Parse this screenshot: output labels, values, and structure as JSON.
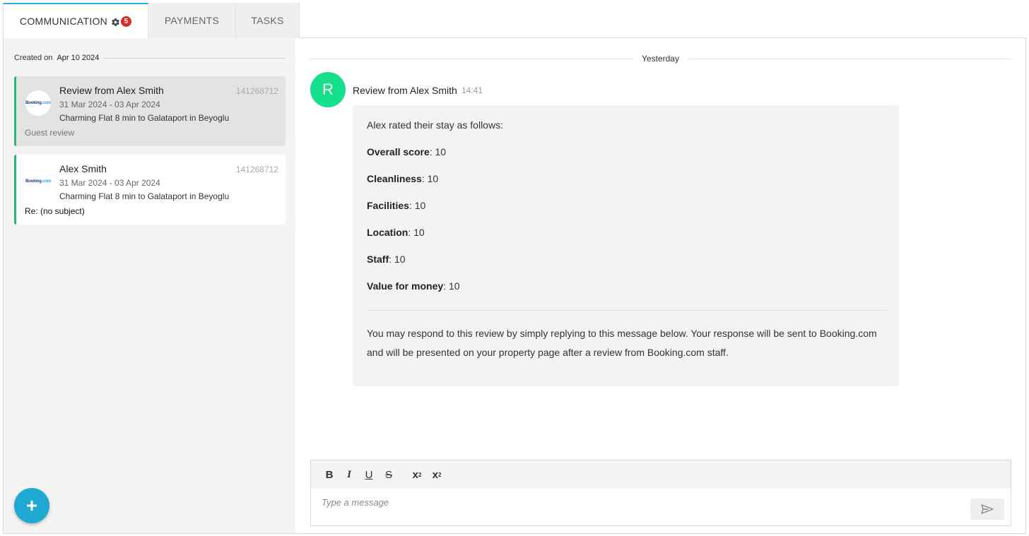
{
  "tabs": [
    {
      "label": "COMMUNICATION",
      "badge": "5",
      "active": true
    },
    {
      "label": "PAYMENTS",
      "active": false
    },
    {
      "label": "TASKS",
      "active": false
    }
  ],
  "sidebar": {
    "created_label": "Created on",
    "created_date": "Apr 10 2024",
    "conversations": [
      {
        "title": "Review from Alex Smith",
        "number": "141268712",
        "dates": "31 Mar 2024 - 03 Apr 2024",
        "property": "Charming Flat 8 min to Galataport in Beyoglu",
        "footer": "Guest review",
        "logo_main": "Booking",
        "logo_suffix": ".com"
      },
      {
        "title": "Alex Smith",
        "number": "141268712",
        "dates": "31 Mar 2024 - 03 Apr 2024",
        "property": "Charming Flat 8 min to Galataport in Beyoglu",
        "footer": "Re: (no subject)",
        "logo_main": "Booking",
        "logo_suffix": ".com"
      }
    ],
    "fab_icon": "plus-icon"
  },
  "chat": {
    "day_separator": "Yesterday",
    "message": {
      "avatar_letter": "R",
      "avatar_color": "#16e08c",
      "sender": "Review from Alex Smith",
      "time": "14:41",
      "intro": "Alex rated their stay as follows:",
      "ratings": [
        {
          "label": "Overall score",
          "value": ": 10"
        },
        {
          "label": "Cleanliness",
          "value": ": 10"
        },
        {
          "label": "Facilities",
          "value": ": 10"
        },
        {
          "label": "Location",
          "value": ": 10"
        },
        {
          "label": "Staff",
          "value": ": 10"
        },
        {
          "label": "Value for money",
          "value": ": 10"
        }
      ],
      "note": "You may respond to this review by simply replying to this message below. Your response will be sent to Booking.com and will be presented on your property page after a review from Booking.com staff."
    },
    "editor": {
      "placeholder": "Type a message",
      "bold": "B",
      "italic": "I",
      "underline": "U",
      "strike": "S",
      "subscript": "x",
      "superscript": "x",
      "sub_mark": "2",
      "sup_mark": "2"
    }
  },
  "colors": {
    "accent": "#29a7df",
    "card_border": "#2bb673",
    "badge": "#d32f2f",
    "fab": "#1ea8d2"
  }
}
